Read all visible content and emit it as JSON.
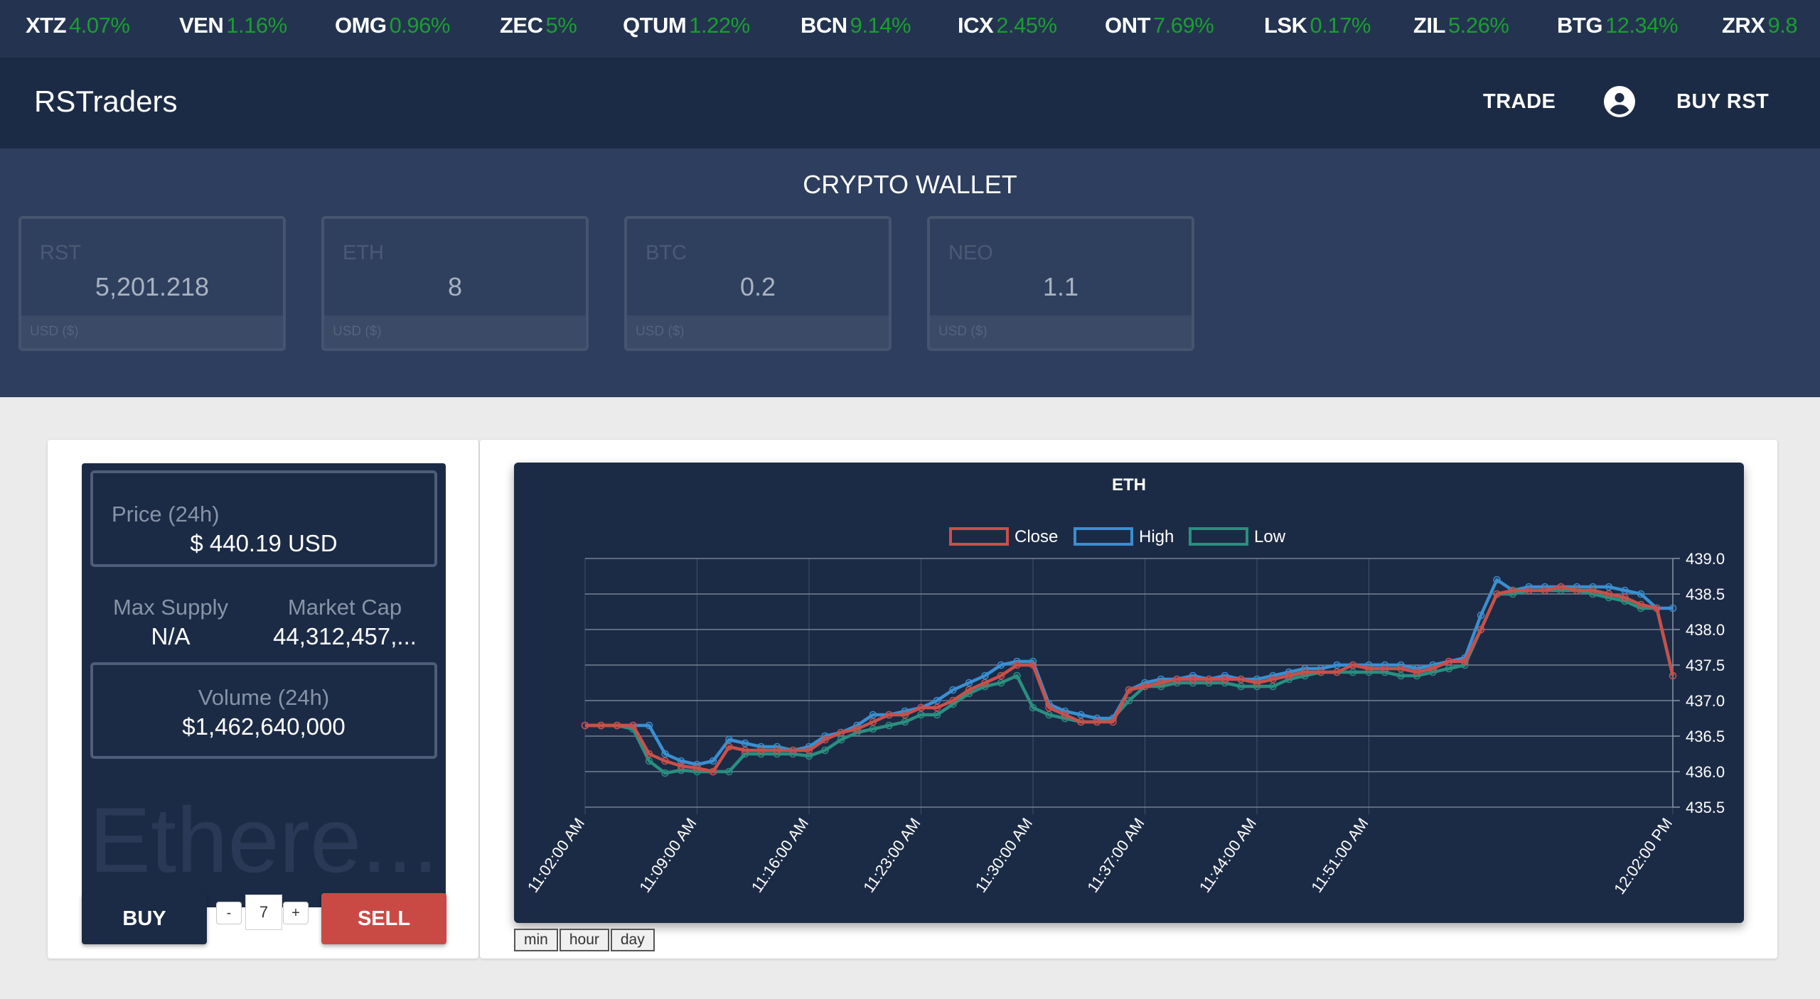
{
  "ticker": [
    {
      "sym": "XTZ",
      "pct": "4.07%"
    },
    {
      "sym": "VEN",
      "pct": "1.16%"
    },
    {
      "sym": "OMG",
      "pct": "0.96%"
    },
    {
      "sym": "ZEC",
      "pct": "5%"
    },
    {
      "sym": "QTUM",
      "pct": "1.22%"
    },
    {
      "sym": "BCN",
      "pct": "9.14%"
    },
    {
      "sym": "ICX",
      "pct": "2.45%"
    },
    {
      "sym": "ONT",
      "pct": "7.69%"
    },
    {
      "sym": "LSK",
      "pct": "0.17%"
    },
    {
      "sym": "ZIL",
      "pct": "5.26%"
    },
    {
      "sym": "BTG",
      "pct": "12.34%"
    },
    {
      "sym": "ZRX",
      "pct": "9.8"
    }
  ],
  "nav": {
    "brand": "RSTraders",
    "trade": "TRADE",
    "buy_rst": "BUY RST",
    "account_icon": "account-circle-icon"
  },
  "wallet": {
    "title": "CRYPTO WALLET",
    "cards": [
      {
        "sym": "RST",
        "amount": "5,201.218",
        "usd": "USD ($)"
      },
      {
        "sym": "ETH",
        "amount": "8",
        "usd": "USD ($)"
      },
      {
        "sym": "BTC",
        "amount": "0.2",
        "usd": "USD ($)"
      },
      {
        "sym": "NEO",
        "amount": "1.1",
        "usd": "USD ($)"
      }
    ]
  },
  "coin": {
    "price_label": "Price (24h)",
    "price_value": "$ 440.19 USD",
    "max_supply_label": "Max Supply",
    "max_supply_value": "N/A",
    "market_cap_label": "Market Cap",
    "market_cap_value": "44,312,457,...",
    "volume_label": "Volume (24h)",
    "volume_value": "$1,462,640,000",
    "watermark": "Ethere..."
  },
  "trade": {
    "buy": "BUY",
    "sell": "SELL",
    "minus": "-",
    "plus": "+",
    "qty": "7"
  },
  "ranges": [
    "min",
    "hour",
    "day"
  ],
  "colors": {
    "close": "#c9504a",
    "high": "#3a8fd0",
    "low": "#2a8f80",
    "buy": "#1c2b45",
    "sell": "#c94a45",
    "up": "#1a9e2f"
  },
  "chart_data": {
    "type": "line",
    "title": "ETH",
    "x_ticks": [
      "11:02:00 AM",
      "11:09:00 AM",
      "11:16:00 AM",
      "11:23:00 AM",
      "11:30:00 AM",
      "11:37:00 AM",
      "11:44:00 AM",
      "11:51:00 AM",
      "12:02:00 PM"
    ],
    "y_ticks": [
      439.0,
      438.5,
      438.0,
      437.5,
      437.0,
      436.5,
      436.0,
      435.5
    ],
    "ylim": [
      435.5,
      439.0
    ],
    "grid": true,
    "legend": "top",
    "series": [
      {
        "name": "Close",
        "color": "#c9504a",
        "values": [
          436.65,
          436.65,
          436.65,
          436.65,
          436.25,
          436.15,
          436.08,
          436.05,
          436.0,
          436.35,
          436.3,
          436.3,
          436.3,
          436.3,
          436.3,
          436.45,
          436.55,
          436.6,
          436.7,
          436.8,
          436.8,
          436.9,
          436.9,
          437.0,
          437.15,
          437.25,
          437.35,
          437.5,
          437.5,
          436.9,
          436.8,
          436.7,
          436.7,
          436.7,
          437.15,
          437.2,
          437.25,
          437.3,
          437.3,
          437.3,
          437.3,
          437.3,
          437.25,
          437.3,
          437.35,
          437.4,
          437.4,
          437.4,
          437.5,
          437.45,
          437.45,
          437.45,
          437.4,
          437.45,
          437.55,
          437.55,
          438.0,
          438.5,
          438.55,
          438.55,
          438.55,
          438.6,
          438.55,
          438.55,
          438.5,
          438.45,
          438.35,
          438.3,
          437.35
        ]
      },
      {
        "name": "High",
        "color": "#3a8fd0",
        "values": [
          436.65,
          436.65,
          436.65,
          436.65,
          436.65,
          436.25,
          436.15,
          436.1,
          436.15,
          436.45,
          436.4,
          436.35,
          436.35,
          436.3,
          436.35,
          436.5,
          436.55,
          436.65,
          436.8,
          436.8,
          436.85,
          436.9,
          437.0,
          437.15,
          437.25,
          437.35,
          437.5,
          437.55,
          437.55,
          436.95,
          436.85,
          436.8,
          436.75,
          436.75,
          437.15,
          437.25,
          437.3,
          437.3,
          437.35,
          437.3,
          437.35,
          437.3,
          437.3,
          437.35,
          437.4,
          437.45,
          437.45,
          437.5,
          437.5,
          437.5,
          437.5,
          437.5,
          437.45,
          437.5,
          437.55,
          437.6,
          438.2,
          438.7,
          438.55,
          438.6,
          438.6,
          438.6,
          438.6,
          438.6,
          438.6,
          438.55,
          438.5,
          438.3,
          438.3
        ]
      },
      {
        "name": "Low",
        "color": "#2a8f80",
        "values": [
          436.65,
          436.65,
          436.65,
          436.6,
          436.15,
          435.98,
          436.02,
          436.0,
          436.0,
          436.0,
          436.25,
          436.25,
          436.25,
          436.25,
          436.22,
          436.3,
          436.45,
          436.55,
          436.6,
          436.65,
          436.7,
          436.8,
          436.8,
          436.95,
          437.1,
          437.2,
          437.25,
          437.35,
          436.9,
          436.8,
          436.75,
          436.7,
          436.7,
          436.75,
          437.0,
          437.2,
          437.2,
          437.25,
          437.25,
          437.25,
          437.25,
          437.2,
          437.2,
          437.2,
          437.3,
          437.35,
          437.4,
          437.4,
          437.4,
          437.4,
          437.4,
          437.35,
          437.35,
          437.4,
          437.45,
          437.5,
          438.0,
          438.5,
          438.5,
          438.55,
          438.55,
          438.55,
          438.55,
          438.5,
          438.45,
          438.4,
          438.3,
          438.3,
          437.35
        ]
      }
    ]
  }
}
